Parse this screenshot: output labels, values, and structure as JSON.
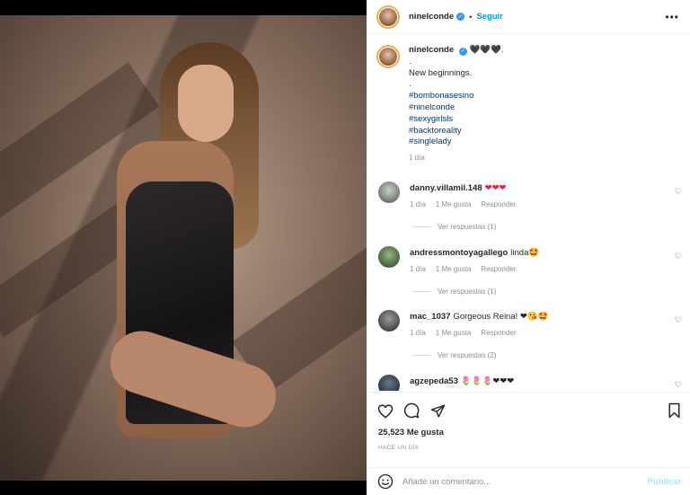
{
  "post": {
    "username": "ninelconde",
    "follow_label": "Seguir",
    "more_label": "•••",
    "verified_mark": "✓",
    "separator": "•"
  },
  "caption": {
    "username": "ninelconde",
    "hearts": "🖤🖤🖤.",
    "line1": ".",
    "line2": "New beginnings.",
    "line3": ".",
    "hashtags": [
      "#bombonasesino",
      "#ninelconde",
      "#sexygirlsls",
      "#backtoreality",
      "#singlelady"
    ],
    "time": "1 día"
  },
  "comments": [
    {
      "username": "danny.villamil.148",
      "text": "❤❤❤",
      "time": "1 día",
      "likes": "1 Me gusta",
      "reply": "Responder",
      "replies": "Ver respuestas (1)"
    },
    {
      "username": "andressmontoyagallego",
      "text": "linda🤩",
      "time": "1 día",
      "likes": "1 Me gusta",
      "reply": "Responder",
      "replies": "Ver respuestas (1)"
    },
    {
      "username": "mac_1037",
      "text": "Gorgeous Reina! ❤😘🤩",
      "time": "1 día",
      "likes": "1 Me gusta",
      "reply": "Responder",
      "replies": "Ver respuestas (2)"
    },
    {
      "username": "agzepeda53",
      "text": "🌷🌷🌷❤❤❤",
      "time": "",
      "likes": "",
      "reply": "",
      "replies": ""
    }
  ],
  "icons": {
    "like": "heart-icon",
    "comment": "comment-icon",
    "share": "paper-plane-icon",
    "save": "bookmark-icon",
    "emoji": "smiley-icon"
  },
  "stats": {
    "likes": "25,523 Me gusta",
    "time_ago": "HACE UN DÍA"
  },
  "comment_box": {
    "placeholder": "Añade un comentario...",
    "publish_label": "Publicar"
  },
  "colors": {
    "link": "#0095f6",
    "hashtag": "#00376b",
    "heart": "#ed1d3a",
    "muted": "#8e8e8e"
  }
}
